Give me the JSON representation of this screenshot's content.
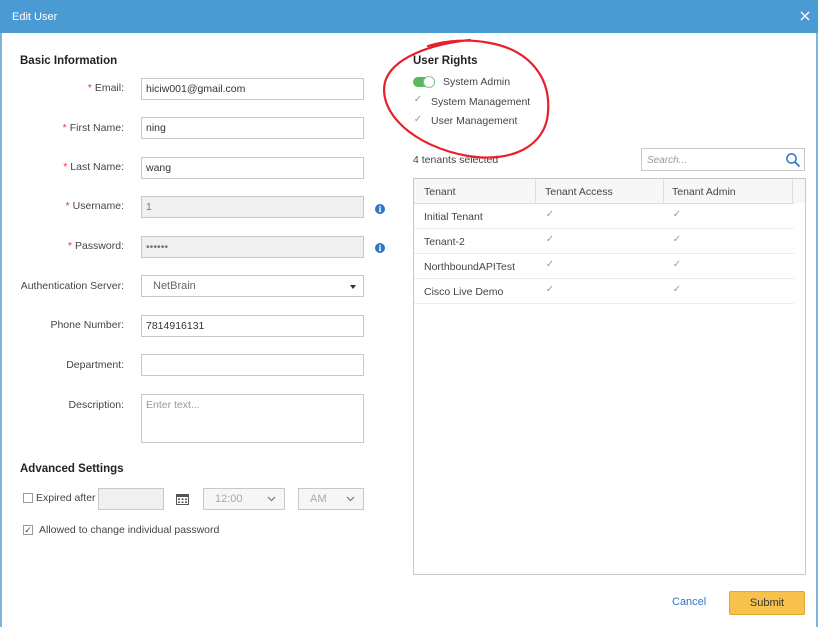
{
  "dialog": {
    "title": "Edit User"
  },
  "basic": {
    "title": "Basic Information",
    "email": {
      "label": "Email:",
      "value": "hiciw001@gmail.com"
    },
    "first_name": {
      "label": "First Name:",
      "value": "ning"
    },
    "last_name": {
      "label": "Last Name:",
      "value": "wang"
    },
    "username": {
      "label": "Username:",
      "value": "1"
    },
    "password": {
      "label": "Password:",
      "value": "••••••"
    },
    "auth_server": {
      "label": "Authentication Server:",
      "value": "NetBrain"
    },
    "phone": {
      "label": "Phone Number:",
      "value": "7814916131"
    },
    "department": {
      "label": "Department:",
      "value": ""
    },
    "description": {
      "label": "Description:",
      "placeholder": "Enter text..."
    },
    "required_mark": "*"
  },
  "advanced": {
    "title": "Advanced Settings",
    "expired_label": "Expired after",
    "time_value": "12:00",
    "ampm_value": "AM",
    "allow_change_label": "Allowed to change individual password"
  },
  "rights": {
    "title": "User Rights",
    "system_admin": "System Admin",
    "system_management": "System Management",
    "user_management": "User Management"
  },
  "tenants": {
    "count_label": "4 tenants selected",
    "search_placeholder": "Search...",
    "headers": [
      "Tenant",
      "Tenant Access",
      "Tenant Admin"
    ],
    "rows": [
      {
        "name": "Initial Tenant"
      },
      {
        "name": "Tenant-2"
      },
      {
        "name": "NorthboundAPITest"
      },
      {
        "name": "Cisco Live Demo"
      }
    ]
  },
  "footer": {
    "cancel_label": "Cancel",
    "submit_label": "Submit"
  },
  "colors": {
    "titlebar": "#4a9bd4",
    "submit": "#f8c14b",
    "toggle_on": "#5cb85c",
    "required": "#e33333",
    "annotation": "#e8202a"
  }
}
